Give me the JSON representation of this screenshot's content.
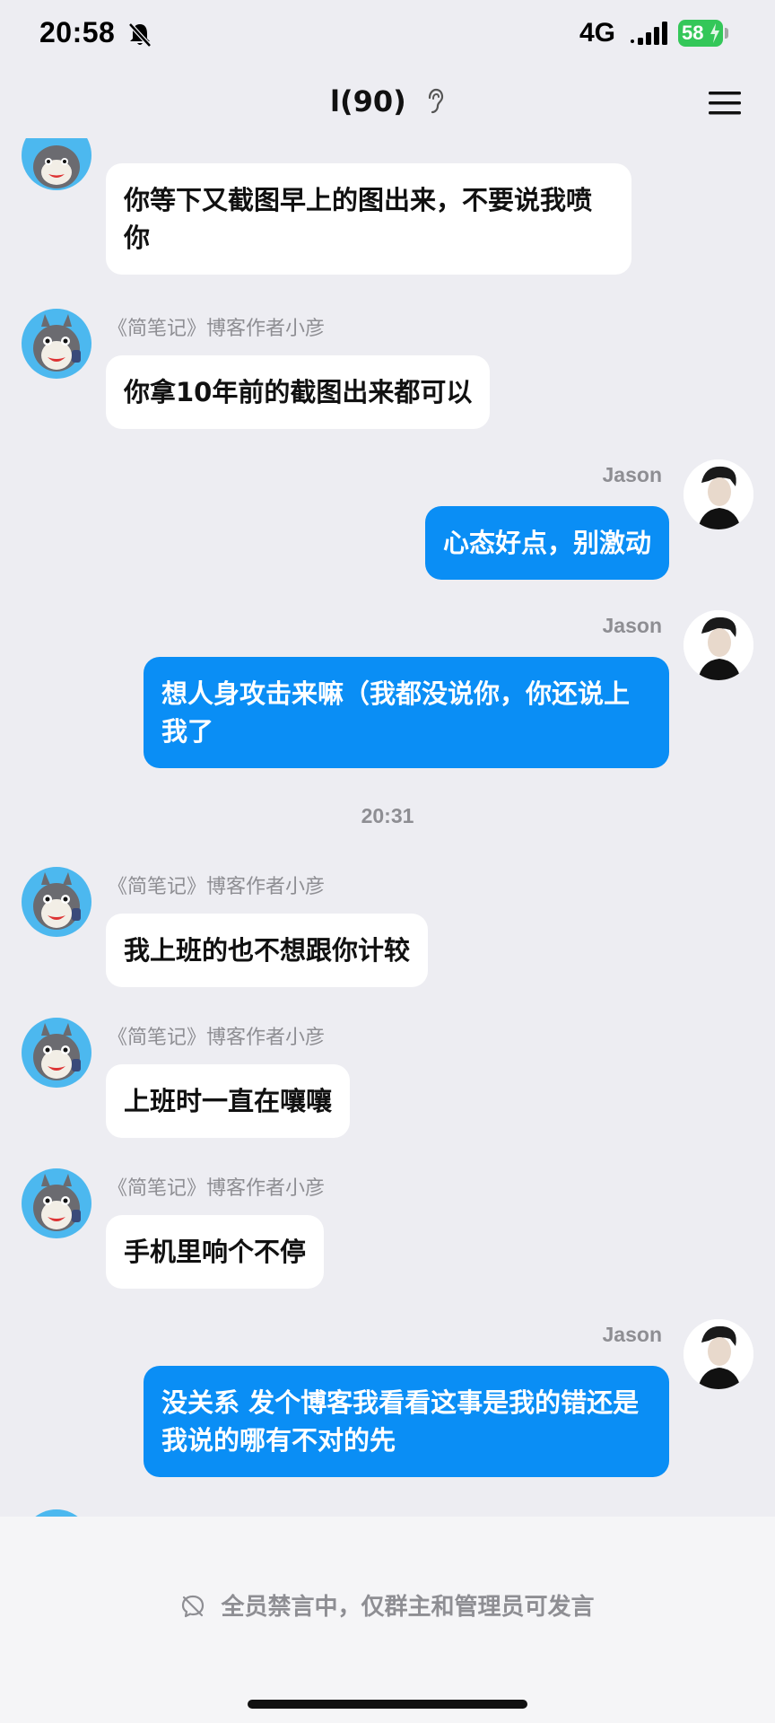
{
  "status_bar": {
    "time": "20:58",
    "network": "4G",
    "battery": "58",
    "icons": [
      "bell-muted-icon",
      "signal-icon",
      "battery-icon",
      "bolt-icon"
    ]
  },
  "header": {
    "title": "l(90)",
    "icons": [
      "ear-icon",
      "menu-icon"
    ]
  },
  "colors": {
    "background": "#ededf2",
    "bubble_self": "#0a8ef5",
    "bubble_other": "#ffffff",
    "avatar_bg": "#4cb8ef",
    "battery": "#34c759"
  },
  "messages": [
    {
      "side": "left",
      "sender": "",
      "text": "你等下又截图早上的图出来，不要说我喷你"
    },
    {
      "side": "left",
      "sender": "《简笔记》博客作者小彦",
      "text": "你拿10年前的截图出来都可以"
    },
    {
      "side": "right",
      "sender": "Jason",
      "text": "心态好点，别激动"
    },
    {
      "side": "right",
      "sender": "Jason",
      "text": "想人身攻击来嘛（我都没说你，你还说上我了"
    },
    {
      "side": "left",
      "sender": "《简笔记》博客作者小彦",
      "text": "我上班的也不想跟你计较"
    },
    {
      "side": "left",
      "sender": "《简笔记》博客作者小彦",
      "text": "上班时一直在嚷嚷"
    },
    {
      "side": "left",
      "sender": "《简笔记》博客作者小彦",
      "text": "手机里响个不停"
    },
    {
      "side": "right",
      "sender": "Jason",
      "text": "没关系 发个博客我看看这事是我的错还是我说的哪有不对的先"
    }
  ],
  "time_divider": "20:31",
  "footer": {
    "mute_notice": "全员禁言中，仅群主和管理员可发言"
  }
}
